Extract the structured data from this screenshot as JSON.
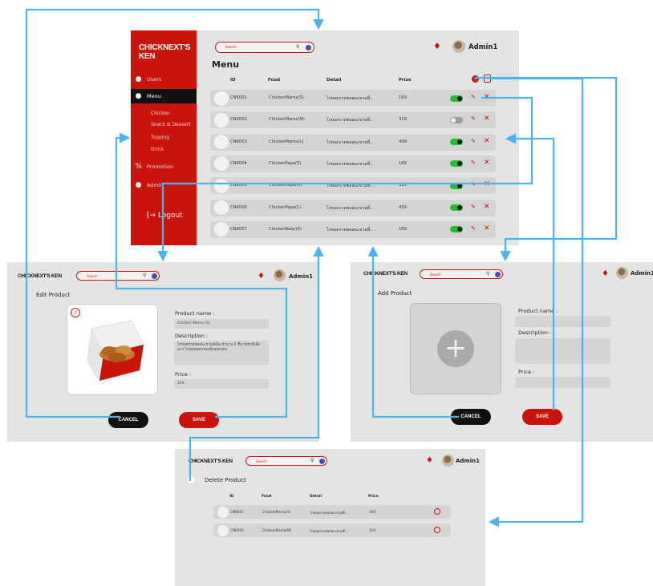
{
  "brand": "CHICKNEXT'S KEN",
  "search": {
    "placeholder": "Search"
  },
  "user": "Admin1",
  "sidebar": {
    "items": [
      {
        "label": "Users"
      },
      {
        "label": "Menu"
      },
      {
        "label": "Promotion"
      },
      {
        "label": "Admin"
      }
    ],
    "subitems": [
      "Chicken",
      "Snack & Dessert",
      "Topping",
      "Drink"
    ],
    "logout": "Logout"
  },
  "menu": {
    "title": "Menu",
    "columns": [
      "ID",
      "Food",
      "Detail",
      "Prize"
    ],
    "rows": [
      {
        "id": "CNK001",
        "food": "ChickenMama(S)",
        "detail": "ไก่ทอดราดซอสมะขามพี่...",
        "price": "169",
        "enabled": true
      },
      {
        "id": "CNK002",
        "food": "ChickenMama(M)",
        "detail": "ไก่ทอดราดซอสมะขามพี่...",
        "price": "319",
        "enabled": false
      },
      {
        "id": "CNK003",
        "food": "ChickenMama(L)",
        "detail": "ไก่ทอดราดซอสมะขามพี่...",
        "price": "459",
        "enabled": true
      },
      {
        "id": "CNK004",
        "food": "ChickenPapa(S)",
        "detail": "ไก่ทอดราดซอสมะขามพี่...",
        "price": "169",
        "enabled": true
      },
      {
        "id": "CNK005",
        "food": "ChickenPapa(M)",
        "detail": "ไก่ทอดราดซอสมะขามพี่...",
        "price": "319",
        "enabled": true
      },
      {
        "id": "CNK006",
        "food": "ChickenPapa(L)",
        "detail": "ไก่ทอดราดซอสมะขามพี่...",
        "price": "459",
        "enabled": true
      },
      {
        "id": "CNK007",
        "food": "ChickenBaby(S)",
        "detail": "ไก่ทอดราดซอสมะขามพี่...",
        "price": "169",
        "enabled": true
      }
    ]
  },
  "edit": {
    "title": "Edit Product",
    "name_label": "Product name :",
    "name_value": "Chicken Mama (S)",
    "desc_label": "Description :",
    "desc_value": "ไก่ทอดราดซอสมะขามพี่เผ็ด จำนวน 6 ชิ้น รสชาติเผ็ดมาก ไก่นุ่มทอดกรอบทั้งนอกนอก",
    "price_label": "Price :",
    "price_value": "169",
    "cancel": "CANCEL",
    "save": "SAVE"
  },
  "add": {
    "title": "Add Product",
    "name_label": "Product name :",
    "desc_label": "Description :",
    "price_label": "Price :",
    "cancel": "CANCEL",
    "save": "SAVE"
  },
  "delete": {
    "title": "Delete Product",
    "columns": [
      "ID",
      "Food",
      "Detail",
      "Price"
    ],
    "rows": [
      {
        "id": "CNK001",
        "food": "ChickenMama(S)",
        "detail": "ไก่ทอดราดซอสมะขามพี่...",
        "price": "169"
      },
      {
        "id": "CNK002",
        "food": "ChickenMama(M)",
        "detail": "ไก่ทอดราดซอสมะขามพี่...",
        "price": "319"
      }
    ]
  },
  "colors": {
    "brand_red": "#c8140c",
    "frame_gray": "#e4e4e4",
    "row_gray": "#d4d4d4",
    "arrow_blue": "#4db3f0",
    "toggle_on": "#22c02c"
  }
}
